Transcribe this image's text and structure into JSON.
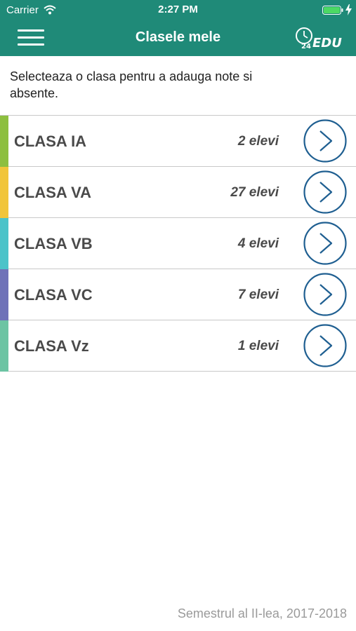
{
  "status_bar": {
    "carrier": "Carrier",
    "time": "2:27 PM",
    "battery_icon": "battery-charging-icon",
    "wifi_icon": "wifi-icon"
  },
  "nav": {
    "title": "Clasele mele",
    "menu_icon": "hamburger-menu-icon",
    "logo_text": "EDU",
    "logo_number": "24",
    "background_color": "#1f8a78"
  },
  "instruction": "Selecteaza o clasa pentru a adauga note si absente.",
  "classes": [
    {
      "name": "CLASA IA",
      "students": "2 elevi",
      "color": "#8dbf3f"
    },
    {
      "name": "CLASA VA",
      "students": "27 elevi",
      "color": "#f1c53a"
    },
    {
      "name": "CLASA VB",
      "students": "4 elevi",
      "color": "#4bc3c9"
    },
    {
      "name": "CLASA VC",
      "students": "7 elevi",
      "color": "#6f72b8"
    },
    {
      "name": "CLASA Vz",
      "students": "1 elevi",
      "color": "#6cc4a3"
    }
  ],
  "arrow_color": "#1f5f91",
  "footer": {
    "semester": "Semestrul al II-lea, 2017-2018"
  }
}
